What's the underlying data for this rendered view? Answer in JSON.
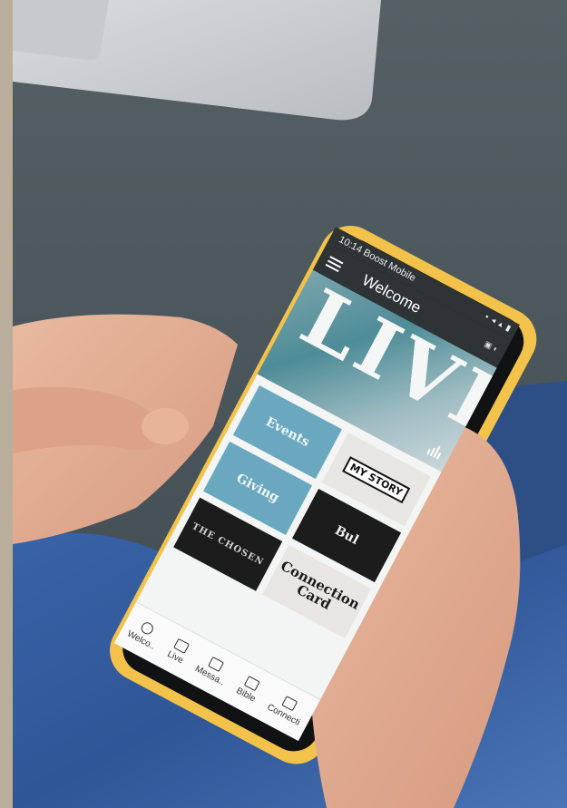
{
  "status_bar": {
    "carrier": "10:14 Boost Mobile"
  },
  "app_bar": {
    "title": "Welcome"
  },
  "hero": {
    "text": "LIVE"
  },
  "tiles": [
    {
      "label": "Events"
    },
    {
      "label": "MY STORY"
    },
    {
      "label": "Giving"
    },
    {
      "label": "Bul"
    },
    {
      "label": "THE CHOSEN"
    },
    {
      "label": "Connection Card"
    }
  ],
  "tab_bar": {
    "items": [
      {
        "label": "Welco..",
        "icon": "chat-bubble-icon"
      },
      {
        "label": "Live",
        "icon": "tv-icon"
      },
      {
        "label": "Messa..",
        "icon": "video-icon"
      },
      {
        "label": "Bible",
        "icon": "book-icon"
      },
      {
        "label": "Connecti",
        "icon": "connection-icon"
      }
    ]
  },
  "colors": {
    "accent": "#6aa8c0",
    "case": "#f2c24a",
    "jeans": "#3c64a8"
  }
}
